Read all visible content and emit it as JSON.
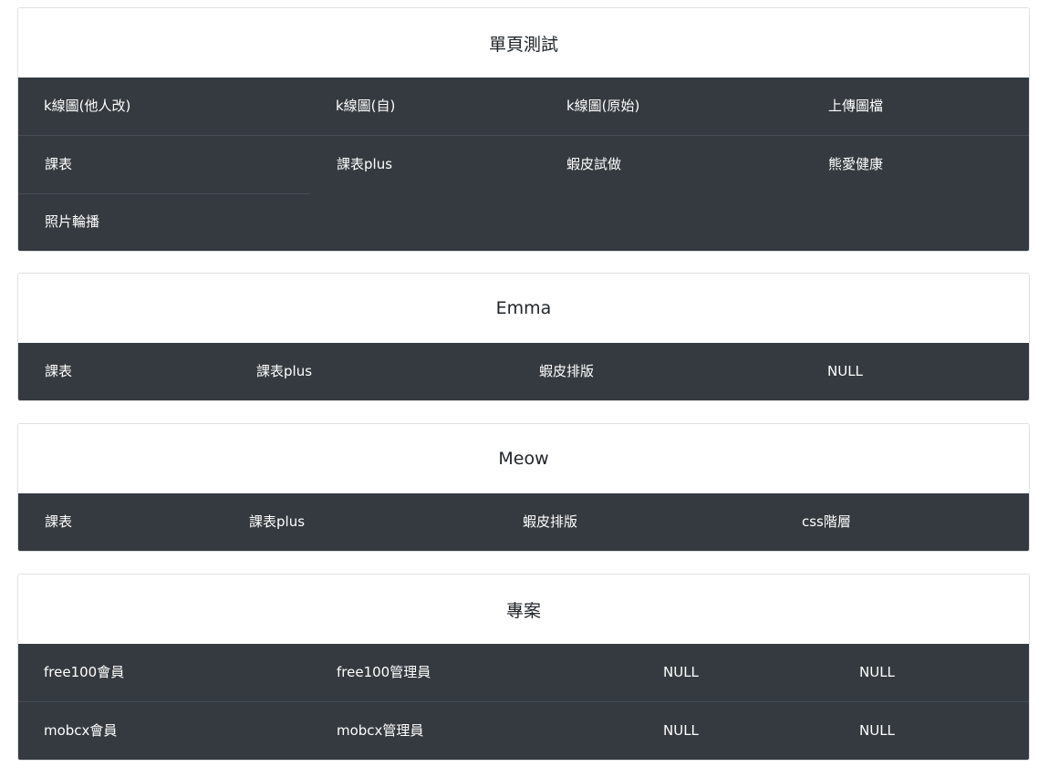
{
  "sections": [
    {
      "title": "單頁測試",
      "rows": [
        [
          "k線圖(他人改)",
          "k線圖(自)",
          "k線圖(原始)",
          "上傳圖檔"
        ],
        [
          "課表",
          "課表plus",
          "蝦皮試做",
          "熊愛健康"
        ],
        [
          "照片輪播"
        ]
      ]
    },
    {
      "title": "Emma",
      "rows": [
        [
          "課表",
          "課表plus",
          "蝦皮排版",
          "NULL"
        ]
      ]
    },
    {
      "title": "Meow",
      "rows": [
        [
          "課表",
          "課表plus",
          "蝦皮排版",
          "css階層"
        ]
      ]
    },
    {
      "title": "專案",
      "rows": [
        [
          "free100會員",
          "free100管理員",
          "NULL",
          "NULL"
        ],
        [
          "mobcx會員",
          "mobcx管理員",
          "NULL",
          "NULL"
        ]
      ]
    }
  ]
}
